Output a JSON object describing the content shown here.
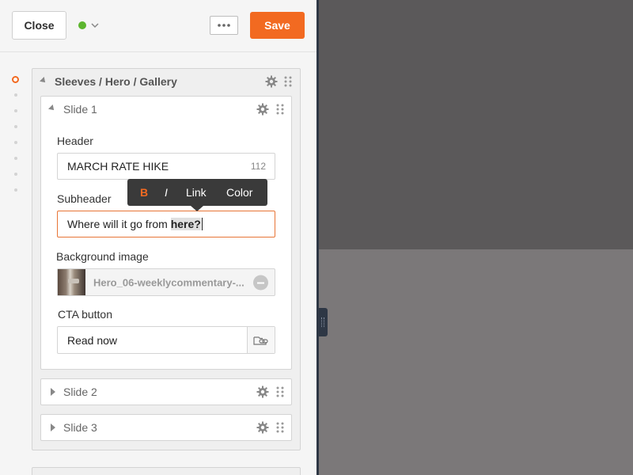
{
  "topbar": {
    "close_label": "Close",
    "save_label": "Save",
    "status_color": "#5cb52e",
    "accent_color": "#f26a21"
  },
  "outline": {
    "breadcrumb": "Sleeves / Hero / Gallery",
    "slides": [
      {
        "label": "Slide 1",
        "expanded": true
      },
      {
        "label": "Slide 2",
        "expanded": false
      },
      {
        "label": "Slide 3",
        "expanded": false
      }
    ]
  },
  "slide1": {
    "header_label": "Header",
    "header_value": "MARCH RATE HIKE",
    "header_char_count": "112",
    "subheader_label": "Subheader",
    "subheader_before": "Where will it go from ",
    "subheader_selected": "here?",
    "background_label": "Background image",
    "background_file": "Hero_06-weeklycommentary-...",
    "cta_label": "CTA button",
    "cta_value": "Read now"
  },
  "format_toolbar": {
    "bold": "B",
    "italic": "I",
    "link": "Link",
    "color": "Color"
  },
  "icons": [
    "chevron-down-icon",
    "more-icon",
    "gear-icon",
    "drag-handle-icon",
    "link-icon",
    "remove-icon"
  ]
}
